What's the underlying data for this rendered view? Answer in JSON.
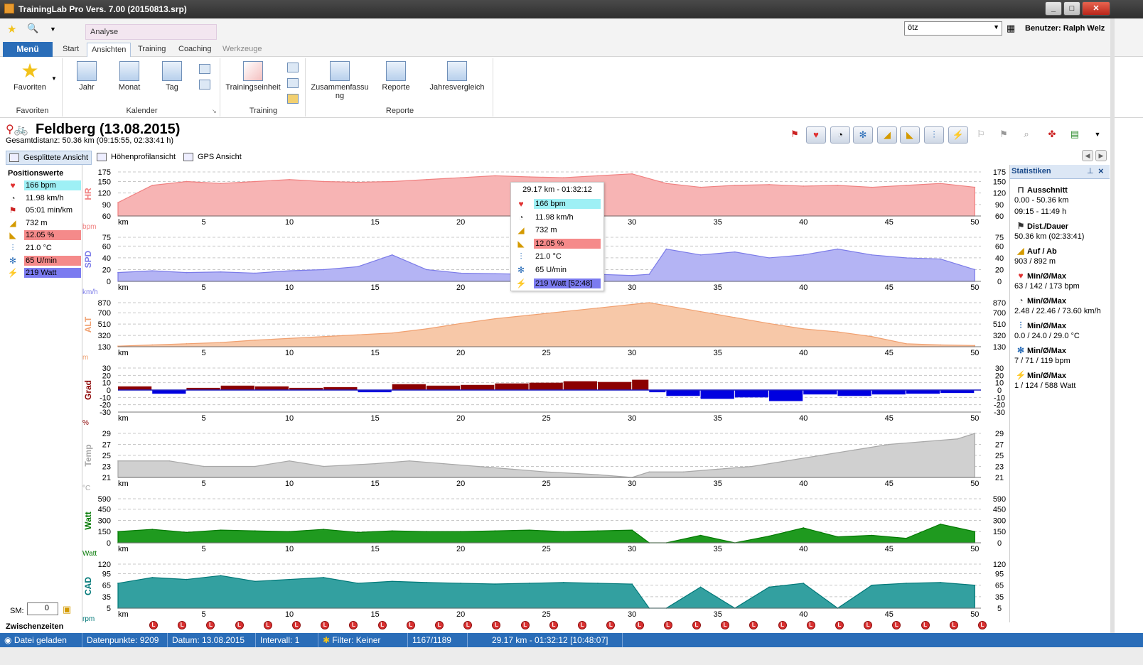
{
  "window": {
    "title": "TrainingLab Pro Vers. 7.00 (20150813.srp)"
  },
  "ribbon": {
    "context_label": "Analyse",
    "menu_label": "Menü",
    "tabs": [
      {
        "label": "Start"
      },
      {
        "label": "Ansichten"
      },
      {
        "label": "Training"
      },
      {
        "label": "Coaching"
      },
      {
        "label": "Werkzeuge"
      }
    ],
    "groups": {
      "favoriten": {
        "label": "Favoriten",
        "button": "Favoriten"
      },
      "kalender": {
        "label": "Kalender",
        "buttons": [
          "Jahr",
          "Monat",
          "Tag"
        ]
      },
      "training": {
        "label": "Training",
        "buttons": [
          "Trainingseinheit"
        ]
      },
      "reporte": {
        "label": "Reporte",
        "buttons": [
          "Zusammenfassu ng",
          "Reporte",
          "Jahresvergleich"
        ]
      }
    },
    "search_value": "ötz",
    "user_label": "Benutzer: Ralph Welz"
  },
  "activity": {
    "title": "Feldberg (13.08.2015)",
    "subtitle": "Gesamtdistanz: 50.36 km (09:15:55, 02:33:41 h)"
  },
  "views": [
    "Gesplittete Ansicht",
    "Höhenprofilansicht",
    "GPS Ansicht"
  ],
  "position_values": {
    "title": "Positionswerte",
    "rows": [
      {
        "icon": "heart-icon",
        "value": "166 bpm",
        "bg": "#9ef0f5"
      },
      {
        "icon": "speedometer-icon",
        "value": "11.98 km/h",
        "bg": ""
      },
      {
        "icon": "runner-icon",
        "value": "05:01 min/km",
        "bg": ""
      },
      {
        "icon": "altitude-icon",
        "value": "732 m",
        "bg": ""
      },
      {
        "icon": "gradient-icon",
        "value": "12.05 %",
        "bg": "#f58a8a"
      },
      {
        "icon": "thermometer-icon",
        "value": "21.0 °C",
        "bg": ""
      },
      {
        "icon": "cadence-icon",
        "value": "65 U/min",
        "bg": "#f58a8a"
      },
      {
        "icon": "power-icon",
        "value": "219 Watt",
        "bg": "#7b7bf0"
      }
    ],
    "sm_label": "SM:",
    "sm_value": "0"
  },
  "tooltip": {
    "header": "29.17 km - 01:32:12",
    "rows": [
      {
        "icon": "heart-icon",
        "value": "166 bpm",
        "bg": "#9ef0f5"
      },
      {
        "icon": "speedometer-icon",
        "value": "11.98 km/h",
        "bg": ""
      },
      {
        "icon": "altitude-icon",
        "value": "732 m",
        "bg": ""
      },
      {
        "icon": "gradient-icon",
        "value": "12.05 %",
        "bg": "#f58a8a"
      },
      {
        "icon": "thermometer-icon",
        "value": "21.0 °C",
        "bg": ""
      },
      {
        "icon": "cadence-icon",
        "value": "65 U/min",
        "bg": ""
      },
      {
        "icon": "power-icon",
        "value": "219 Watt [52:48]",
        "bg": "#7b7bf0"
      }
    ]
  },
  "statistics": {
    "title": "Statistiken",
    "sections": [
      {
        "icon": "section-icon",
        "label": "Ausschnitt",
        "values": [
          "0.00 - 50.36 km",
          "09:15 - 11:49 h"
        ]
      },
      {
        "icon": "flag-clock-icon",
        "label": "Dist./Dauer",
        "values": [
          "50.36 km (02:33:41)"
        ]
      },
      {
        "icon": "altitude-icon",
        "label": "Auf / Ab",
        "values": [
          "903 / 892 m"
        ]
      },
      {
        "icon": "heart-icon",
        "label": "Min/Ø/Max",
        "values": [
          "63 / 142 / 173 bpm"
        ]
      },
      {
        "icon": "speedometer-icon",
        "label": "Min/Ø/Max",
        "values": [
          "2.48 / 22.46 / 73.60 km/h"
        ]
      },
      {
        "icon": "thermometer-icon",
        "label": "Min/Ø/Max",
        "values": [
          "0.0 / 24.0 / 29.0 °C"
        ]
      },
      {
        "icon": "cadence-icon",
        "label": "Min/Ø/Max",
        "values": [
          "7 / 71 / 119 bpm"
        ]
      },
      {
        "icon": "power-icon",
        "label": "Min/Ø/Max",
        "values": [
          "1 / 124 / 588 Watt"
        ]
      }
    ]
  },
  "splits": {
    "label": "Zwischenzeiten",
    "marker_letter": "L",
    "marker_count": 30
  },
  "status": {
    "file": "Datei geladen",
    "points": "Datenpunkte: 9209",
    "date": "Datum: 13.08.2015",
    "interval": "Intervall: 1",
    "filter": "Filter: Keiner",
    "index": "1167/1189",
    "position": "29.17 km - 01:32:12 [10:48:07]"
  },
  "chart_data": {
    "type": "area",
    "x_label": "km",
    "x_ticks": [
      5,
      10,
      15,
      20,
      25,
      30,
      35,
      40,
      45,
      50
    ],
    "x_range": [
      0,
      50.36
    ],
    "grid": true,
    "cursor_km": 29.17,
    "panels": [
      {
        "name": "HR",
        "unit": "bpm",
        "ticks": [
          60,
          90,
          120,
          150,
          175
        ],
        "ylim": [
          60,
          175
        ],
        "color": "#f08080",
        "fill": "#f7b4b4",
        "x": [
          0,
          2,
          4,
          6,
          8,
          10,
          12,
          14,
          16,
          18,
          20,
          22,
          24,
          26,
          28,
          30,
          32,
          34,
          36,
          38,
          40,
          42,
          44,
          46,
          48,
          50
        ],
        "y": [
          95,
          140,
          150,
          145,
          150,
          155,
          150,
          148,
          150,
          155,
          160,
          165,
          162,
          160,
          165,
          170,
          145,
          135,
          140,
          142,
          138,
          140,
          135,
          140,
          145,
          135
        ]
      },
      {
        "name": "SPD",
        "unit": "km/h",
        "ticks": [
          0,
          20,
          40,
          60,
          75
        ],
        "ylim": [
          0,
          75
        ],
        "color": "#7b7be8",
        "fill": "#b4b4f4",
        "x": [
          0,
          2,
          4,
          6,
          8,
          10,
          12,
          14,
          16,
          18,
          20,
          22,
          24,
          26,
          28,
          30,
          31,
          32,
          34,
          36,
          38,
          40,
          42,
          44,
          46,
          48,
          50
        ],
        "y": [
          15,
          18,
          15,
          16,
          14,
          18,
          20,
          25,
          45,
          20,
          14,
          13,
          12,
          12,
          12,
          10,
          12,
          55,
          45,
          50,
          40,
          45,
          55,
          45,
          40,
          38,
          20
        ]
      },
      {
        "name": "ALT",
        "unit": "m",
        "ticks": [
          130,
          320,
          510,
          700,
          870
        ],
        "ylim": [
          130,
          870
        ],
        "color": "#f0a070",
        "fill": "#f7c8a8",
        "x": [
          0,
          2,
          4,
          6,
          8,
          10,
          12,
          14,
          16,
          18,
          20,
          22,
          24,
          26,
          28,
          30,
          31,
          32,
          34,
          36,
          38,
          40,
          42,
          44,
          46,
          48,
          50
        ],
        "y": [
          140,
          160,
          180,
          200,
          240,
          270,
          300,
          330,
          360,
          430,
          520,
          600,
          660,
          720,
          780,
          840,
          870,
          820,
          720,
          620,
          520,
          430,
          380,
          300,
          180,
          160,
          150
        ]
      },
      {
        "name": "Grad",
        "unit": "%",
        "ticks": [
          -30,
          -20,
          -10,
          0,
          10,
          20,
          30
        ],
        "ylim": [
          -30,
          30
        ],
        "color": "#8b0000",
        "color_neg": "#0000e0",
        "x": [
          0,
          2,
          4,
          6,
          8,
          10,
          12,
          14,
          16,
          18,
          20,
          22,
          24,
          26,
          28,
          30,
          31,
          32,
          34,
          36,
          38,
          40,
          42,
          44,
          46,
          48,
          50
        ],
        "y": [
          5,
          -5,
          3,
          6,
          5,
          3,
          4,
          -3,
          8,
          6,
          7,
          9,
          10,
          12,
          11,
          14,
          -3,
          -8,
          -12,
          -10,
          -15,
          -6,
          -8,
          -6,
          -5,
          -4,
          -3
        ]
      },
      {
        "name": "Temp",
        "unit": "°C",
        "ticks": [
          21,
          23,
          25,
          27,
          29
        ],
        "ylim": [
          21,
          29
        ],
        "color": "#a8a8a8",
        "fill": "#d0d0d0",
        "x": [
          0,
          3,
          5,
          8,
          10,
          12,
          15,
          17,
          19,
          21,
          23,
          25,
          28,
          30,
          31,
          33,
          35,
          37,
          39,
          41,
          43,
          45,
          47,
          49,
          50
        ],
        "y": [
          24,
          24,
          23,
          23,
          24,
          23,
          23.5,
          24,
          23.5,
          23,
          22.5,
          22,
          21.5,
          21,
          22,
          22,
          22.5,
          23,
          24,
          25,
          26,
          27,
          27.5,
          28,
          29
        ]
      },
      {
        "name": "Watt",
        "unit": "Watt",
        "ticks": [
          0,
          150,
          300,
          450,
          590
        ],
        "ylim": [
          0,
          590
        ],
        "color": "#007800",
        "fill": "#1f9a1f",
        "x": [
          0,
          2,
          4,
          6,
          8,
          10,
          12,
          14,
          16,
          18,
          20,
          22,
          24,
          26,
          28,
          30,
          31,
          32,
          34,
          36,
          38,
          40,
          42,
          44,
          46,
          48,
          50
        ],
        "y": [
          150,
          180,
          140,
          170,
          160,
          150,
          180,
          140,
          160,
          150,
          150,
          160,
          170,
          150,
          160,
          170,
          0,
          0,
          100,
          0,
          90,
          200,
          80,
          100,
          60,
          250,
          150
        ]
      },
      {
        "name": "CAD",
        "unit": "rpm",
        "ticks": [
          5,
          35,
          65,
          95,
          120
        ],
        "ylim": [
          5,
          120
        ],
        "color": "#007878",
        "fill": "#33a0a0",
        "x": [
          0,
          2,
          4,
          6,
          8,
          10,
          12,
          14,
          16,
          18,
          20,
          22,
          24,
          26,
          28,
          30,
          31,
          32,
          34,
          36,
          38,
          40,
          42,
          44,
          46,
          48,
          50
        ],
        "y": [
          70,
          85,
          80,
          90,
          75,
          80,
          85,
          70,
          75,
          72,
          70,
          68,
          70,
          72,
          70,
          68,
          5,
          5,
          60,
          5,
          60,
          70,
          5,
          65,
          70,
          72,
          65
        ]
      }
    ]
  }
}
